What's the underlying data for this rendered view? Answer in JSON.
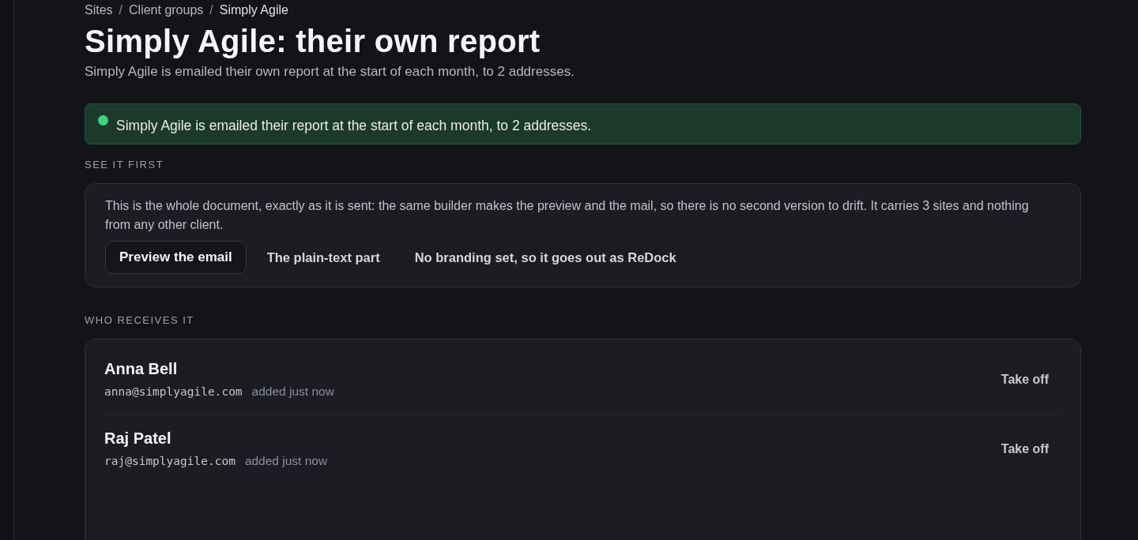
{
  "breadcrumb": [
    {
      "label": "Sites",
      "current": false
    },
    {
      "label": "Client groups",
      "current": false
    },
    {
      "label": "Simply Agile",
      "current": true
    }
  ],
  "breadcrumb_separator": "/",
  "title": "Simply Agile: their own report",
  "subtitle": "Simply Agile is emailed their own report at the start of each month, to 2 addresses.",
  "status": {
    "active": true,
    "text": "Simply Agile is emailed their report at the start of each month, to 2 addresses."
  },
  "preview_section": {
    "heading": "SEE IT FIRST",
    "text": "This is the whole document, exactly as it is sent: the same builder makes the preview and the mail, so there is no second version to drift. It carries 3 sites and nothing from any other client.",
    "actions": [
      {
        "kind": "outlined",
        "label": "Preview the email"
      },
      {
        "kind": "plain",
        "label": "The plain-text part"
      },
      {
        "kind": "plain",
        "label": "No branding set, so it goes out as ReDock"
      }
    ]
  },
  "recipients_section": {
    "heading": "WHO RECEIVES IT",
    "recipients": [
      {
        "name": "Anna Bell",
        "email": "anna@simplyagile.com",
        "added": "added just now",
        "action": "Take off"
      },
      {
        "name": "Raj Patel",
        "email": "raj@simplyagile.com",
        "added": "added just now",
        "action": "Take off"
      }
    ]
  }
}
